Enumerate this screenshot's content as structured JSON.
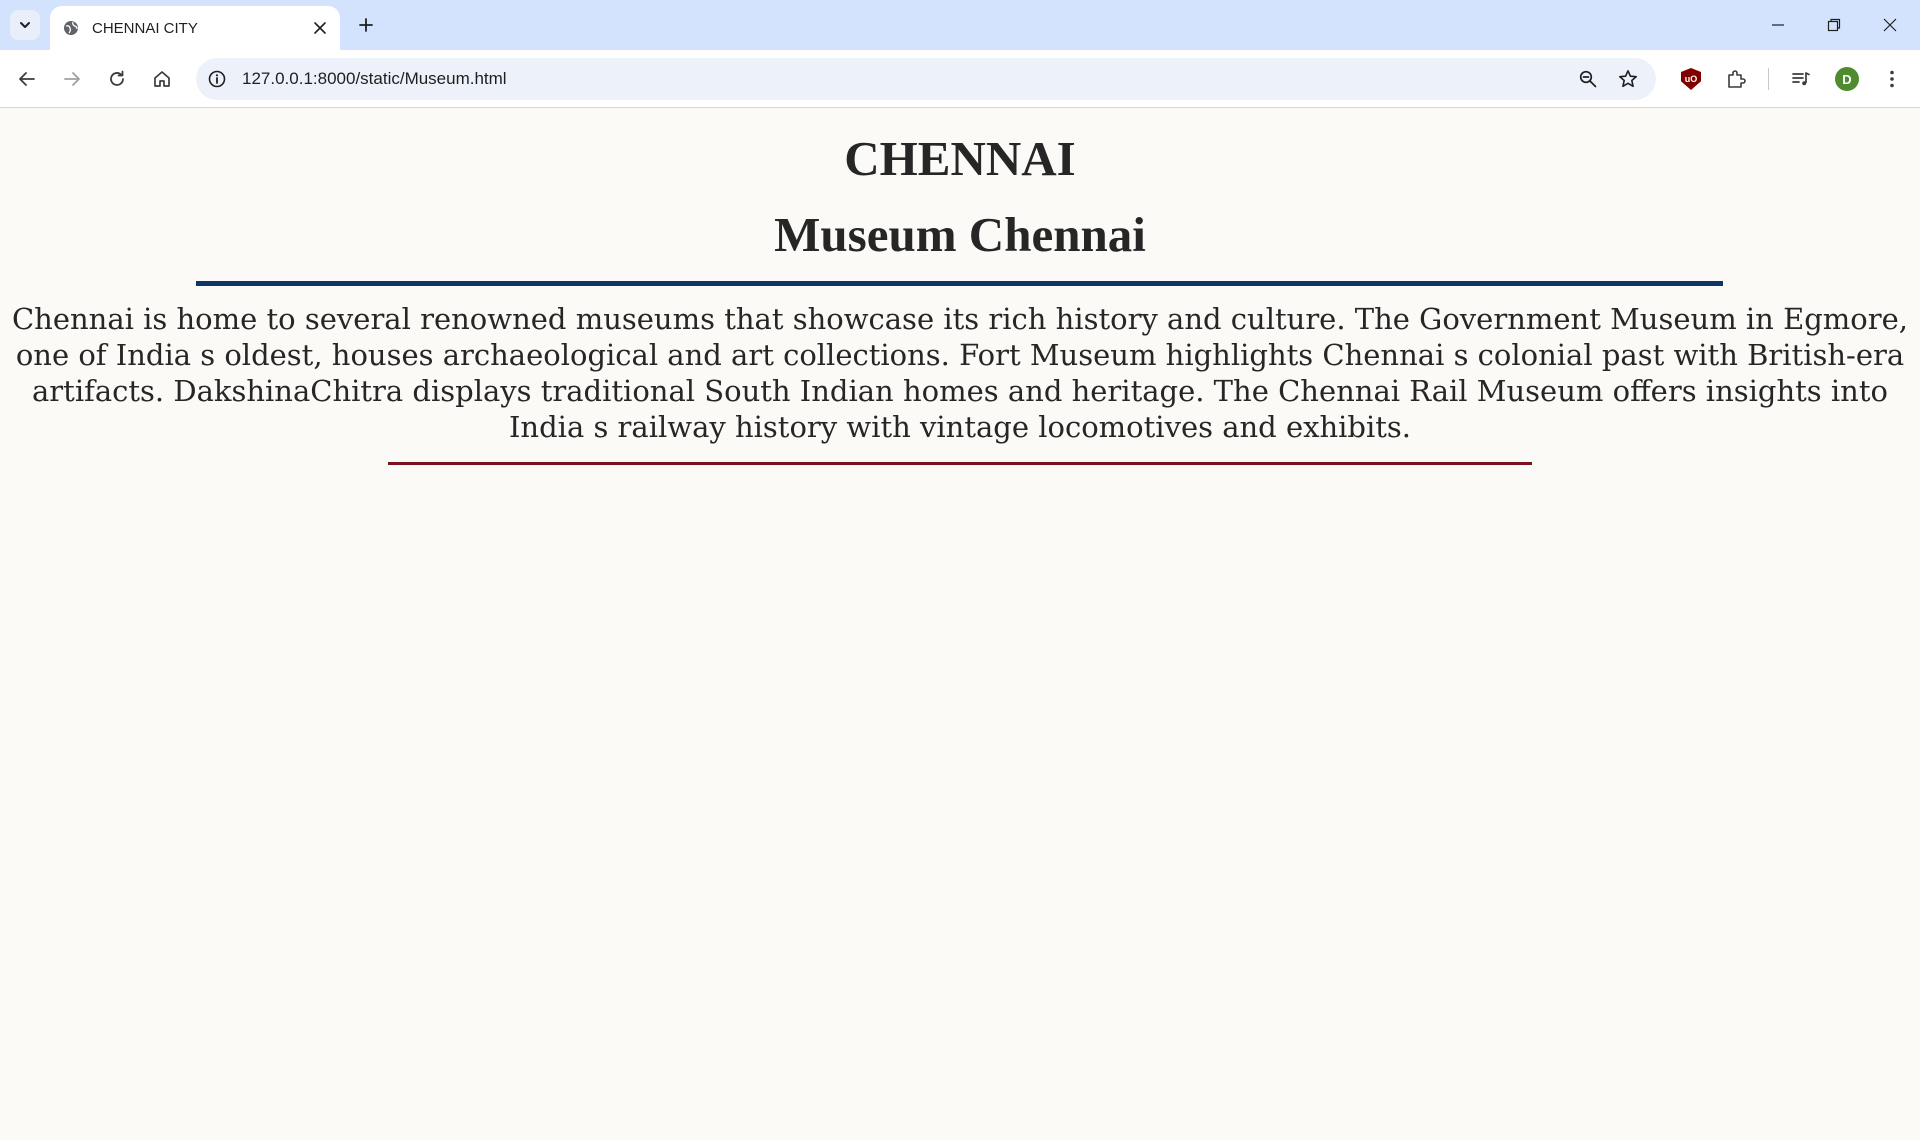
{
  "browser": {
    "tab_title": "CHENNAI CITY",
    "url": "127.0.0.1:8000/static/Museum.html",
    "profile_initial": "D",
    "ublock_label": "uO"
  },
  "page": {
    "city_title": "CHENNAI",
    "section_title": "Museum Chennai",
    "description": "Chennai is home to several renowned museums that showcase its rich history and culture. The Government Museum in Egmore, one of India s oldest, houses archaeological and art collections. Fort Museum highlights Chennai s colonial past with British-era artifacts. DakshinaChitra displays traditional South Indian homes and heritage. The Chennai Rail Museum offers insights into India s railway history with vintage locomotives and exhibits."
  },
  "colors": {
    "tabbar_bg": "#d3e3fd",
    "page_bg": "#fbfaf7",
    "rule_blue": "#0f3466",
    "rule_red": "#7b1221",
    "text": "#262626"
  },
  "icons": [
    "chevron-down-icon",
    "globe-icon",
    "close-icon",
    "plus-icon",
    "minimize-icon",
    "restore-icon",
    "window-close-icon",
    "back-arrow-icon",
    "forward-arrow-icon",
    "reload-icon",
    "home-icon",
    "info-icon",
    "zoom-icon",
    "star-icon",
    "ublock-icon",
    "extensions-icon",
    "media-control-icon",
    "avatar",
    "kebab-menu-icon"
  ]
}
